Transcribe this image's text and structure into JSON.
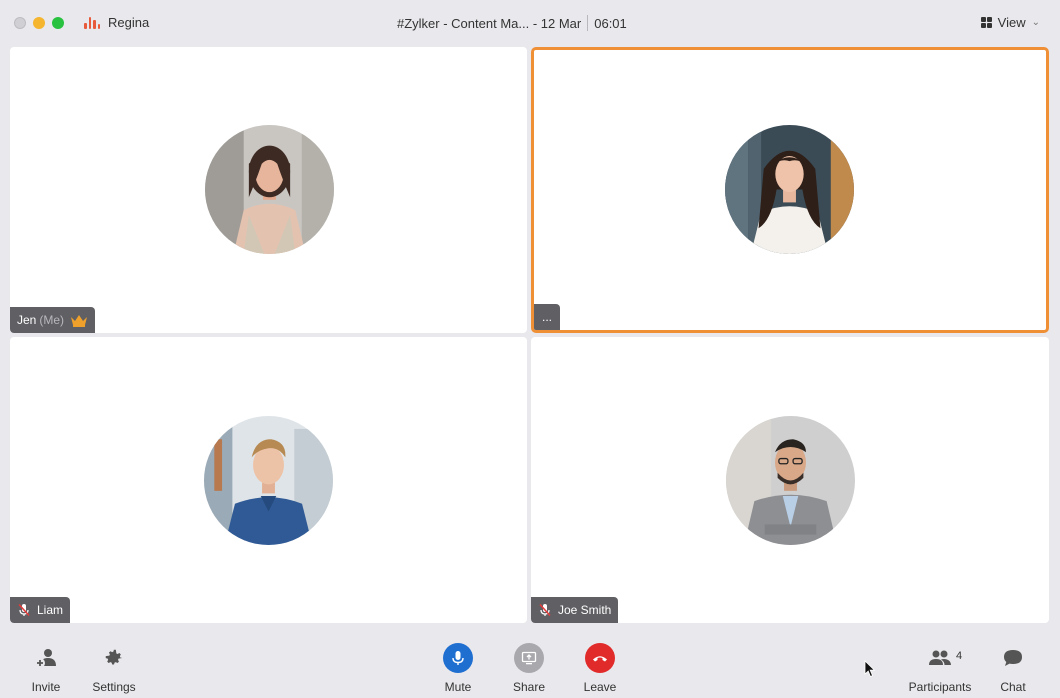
{
  "app": {
    "name": "Regina"
  },
  "meeting": {
    "title": "#Zylker - Content Ma... - 12 Mar",
    "timer": "06:01"
  },
  "view": {
    "label": "View"
  },
  "participants": [
    {
      "name": "Jen",
      "suffix": "(Me)",
      "host": true,
      "muted": false,
      "active": false
    },
    {
      "name": "...",
      "suffix": "",
      "host": false,
      "muted": false,
      "active": true
    },
    {
      "name": "Liam",
      "suffix": "",
      "host": false,
      "muted": true,
      "active": false
    },
    {
      "name": "Joe Smith",
      "suffix": "",
      "host": false,
      "muted": true,
      "active": false
    }
  ],
  "toolbar": {
    "invite": "Invite",
    "settings": "Settings",
    "mute": "Mute",
    "share": "Share",
    "leave": "Leave",
    "participants": "Participants",
    "participants_count": "4",
    "chat": "Chat"
  },
  "colors": {
    "active_border": "#ef8f36",
    "mute": "#1f6fd1",
    "leave": "#e12b2b",
    "brand": "#e85a3c"
  }
}
